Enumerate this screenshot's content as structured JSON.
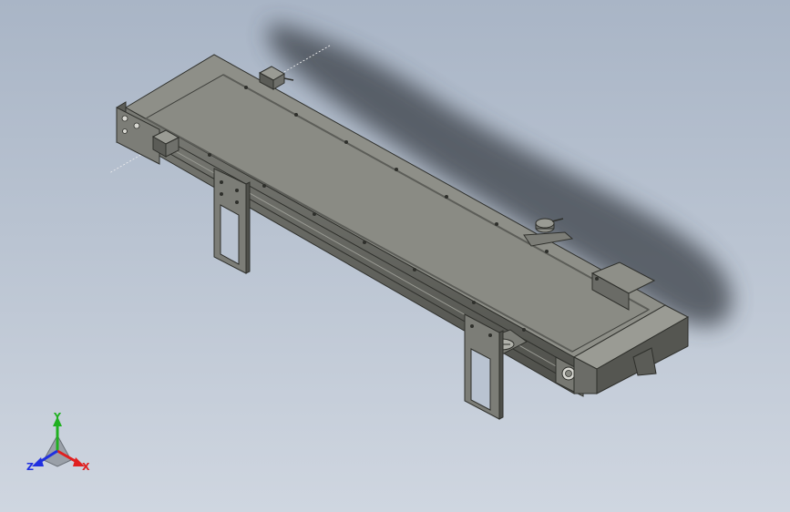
{
  "viewport": {
    "background_top": "#a9b5c6",
    "background_bottom": "#cfd6e0",
    "model": "conveyor-assembly"
  },
  "triad": {
    "x_label": "X",
    "y_label": "Y",
    "z_label": "Z",
    "x_color": "#e02020",
    "y_color": "#20b020",
    "z_color": "#2030e0"
  },
  "colors": {
    "metal_light": "#8e8f88",
    "metal_mid": "#6f706b",
    "metal_dark": "#3f403c",
    "belt": "#8a8b84",
    "shadow": "#3a3f47"
  }
}
